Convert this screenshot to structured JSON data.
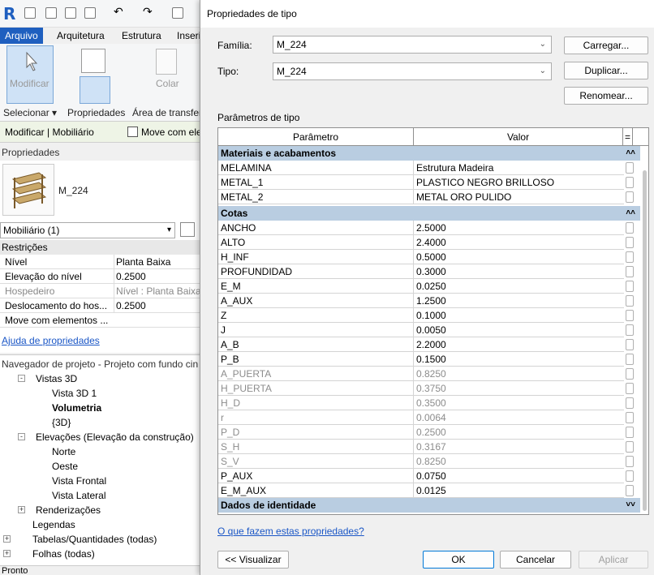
{
  "revit": {
    "tabs": [
      "Arquivo",
      "Arquitetura",
      "Estrutura",
      "Inseri"
    ],
    "ribbon": {
      "modify_label": "Modificar",
      "copy_label": "Colar",
      "select_label": "Selecionar",
      "properties_label": "Propriedades",
      "transfer_label": "Área de transfer"
    },
    "context": {
      "mode_label": "Modificar | Mobiliário",
      "move_with_label": "Move com ele"
    },
    "properties": {
      "title": "Propriedades",
      "type_name": "M_224",
      "category": "Mobiliário (1)",
      "section": "Restrições",
      "rows": [
        {
          "k": "Nível",
          "v": "Planta Baixa"
        },
        {
          "k": "Elevação do nível",
          "v": "0.2500"
        },
        {
          "k": "Hospedeiro",
          "v": "Nível : Planta Baixa"
        },
        {
          "k": "Deslocamento do hos...",
          "v": "0.2500"
        },
        {
          "k": "Move com elementos ...",
          "v": ""
        }
      ],
      "help_link": "Ajuda de propriedades"
    },
    "navigator": {
      "title": "Navegador de projeto - Projeto com fundo cin",
      "items": [
        "Vistas 3D",
        "Vista 3D 1",
        "Volumetria",
        "{3D}",
        "Elevações (Elevação da construção)",
        "Norte",
        "Oeste",
        "Vista Frontal",
        "Vista Lateral",
        "Renderizações",
        "Legendas",
        "Tabelas/Quantidades (todas)",
        "Folhas (todas)"
      ]
    },
    "status": "Pronto"
  },
  "dialog": {
    "title": "Propriedades de tipo",
    "family_label": "Família:",
    "family_value": "M_224",
    "type_label": "Tipo:",
    "type_value": "M_224",
    "load_button": "Carregar...",
    "duplicate_button": "Duplicar...",
    "rename_button": "Renomear...",
    "params_label": "Parâmetros de tipo",
    "col_param": "Parâmetro",
    "col_value": "Valor",
    "col_extra": "=",
    "sections": [
      {
        "name": "Materiais e acabamentos",
        "collapse": "˄˄",
        "rows": [
          {
            "k": "MELAMINA",
            "v": "Estrutura Madeira"
          },
          {
            "k": "METAL_1",
            "v": "PLASTICO NEGRO BRILLOSO"
          },
          {
            "k": "METAL_2",
            "v": "METAL ORO PULIDO"
          }
        ]
      },
      {
        "name": "Cotas",
        "collapse": "˄˄",
        "rows": [
          {
            "k": "ANCHO",
            "v": "2.5000"
          },
          {
            "k": "ALTO",
            "v": "2.4000"
          },
          {
            "k": "H_INF",
            "v": "0.5000"
          },
          {
            "k": "PROFUNDIDAD",
            "v": "0.3000"
          },
          {
            "k": "E_M",
            "v": "0.0250"
          },
          {
            "k": "A_AUX",
            "v": "1.2500"
          },
          {
            "k": "Z",
            "v": "0.1000"
          },
          {
            "k": "J",
            "v": "0.0050"
          },
          {
            "k": "A_B",
            "v": "2.2000"
          },
          {
            "k": "P_B",
            "v": "0.1500"
          },
          {
            "k": "A_PUERTA",
            "v": "0.8250",
            "dis": true
          },
          {
            "k": "H_PUERTA",
            "v": "0.3750",
            "dis": true
          },
          {
            "k": "H_D",
            "v": "0.3500",
            "dis": true
          },
          {
            "k": "r",
            "v": "0.0064",
            "dis": true
          },
          {
            "k": "P_D",
            "v": "0.2500",
            "dis": true
          },
          {
            "k": "S_H",
            "v": "0.3167",
            "dis": true
          },
          {
            "k": "S_V",
            "v": "0.8250",
            "dis": true
          },
          {
            "k": "P_AUX",
            "v": "0.0750"
          },
          {
            "k": "E_M_AUX",
            "v": "0.0125"
          }
        ]
      },
      {
        "name": "Dados de identidade",
        "collapse": "˅˅",
        "rows": []
      }
    ],
    "help_link": "O que fazem estas propriedades?",
    "preview_button": "<< Visualizar",
    "ok_button": "OK",
    "cancel_button": "Cancelar",
    "apply_button": "Aplicar"
  }
}
